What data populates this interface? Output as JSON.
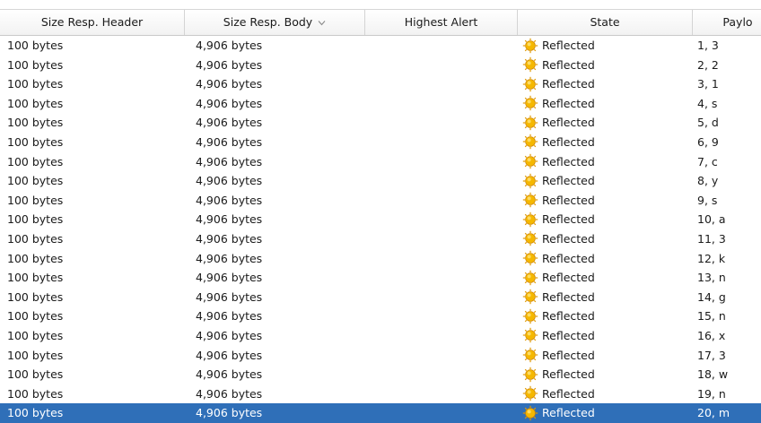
{
  "table": {
    "columns": [
      {
        "label": "Size Resp. Header"
      },
      {
        "label": "Size Resp. Body"
      },
      {
        "label": "Highest Alert"
      },
      {
        "label": "State"
      },
      {
        "label": "Paylo"
      }
    ],
    "sort_icon": "chevron-down-icon",
    "state_icon": "sun-icon",
    "rows": [
      {
        "header_size": "100 bytes",
        "body_size": "4,906 bytes",
        "alert": "",
        "state": "Reflected",
        "payload": "1, 3"
      },
      {
        "header_size": "100 bytes",
        "body_size": "4,906 bytes",
        "alert": "",
        "state": "Reflected",
        "payload": "2, 2"
      },
      {
        "header_size": "100 bytes",
        "body_size": "4,906 bytes",
        "alert": "",
        "state": "Reflected",
        "payload": "3, 1"
      },
      {
        "header_size": "100 bytes",
        "body_size": "4,906 bytes",
        "alert": "",
        "state": "Reflected",
        "payload": "4, s"
      },
      {
        "header_size": "100 bytes",
        "body_size": "4,906 bytes",
        "alert": "",
        "state": "Reflected",
        "payload": "5, d"
      },
      {
        "header_size": "100 bytes",
        "body_size": "4,906 bytes",
        "alert": "",
        "state": "Reflected",
        "payload": "6, 9"
      },
      {
        "header_size": "100 bytes",
        "body_size": "4,906 bytes",
        "alert": "",
        "state": "Reflected",
        "payload": "7, c"
      },
      {
        "header_size": "100 bytes",
        "body_size": "4,906 bytes",
        "alert": "",
        "state": "Reflected",
        "payload": "8, y"
      },
      {
        "header_size": "100 bytes",
        "body_size": "4,906 bytes",
        "alert": "",
        "state": "Reflected",
        "payload": "9, s"
      },
      {
        "header_size": "100 bytes",
        "body_size": "4,906 bytes",
        "alert": "",
        "state": "Reflected",
        "payload": "10, a"
      },
      {
        "header_size": "100 bytes",
        "body_size": "4,906 bytes",
        "alert": "",
        "state": "Reflected",
        "payload": "11, 3"
      },
      {
        "header_size": "100 bytes",
        "body_size": "4,906 bytes",
        "alert": "",
        "state": "Reflected",
        "payload": "12, k"
      },
      {
        "header_size": "100 bytes",
        "body_size": "4,906 bytes",
        "alert": "",
        "state": "Reflected",
        "payload": "13, n"
      },
      {
        "header_size": "100 bytes",
        "body_size": "4,906 bytes",
        "alert": "",
        "state": "Reflected",
        "payload": "14, g"
      },
      {
        "header_size": "100 bytes",
        "body_size": "4,906 bytes",
        "alert": "",
        "state": "Reflected",
        "payload": "15, n"
      },
      {
        "header_size": "100 bytes",
        "body_size": "4,906 bytes",
        "alert": "",
        "state": "Reflected",
        "payload": "16, x"
      },
      {
        "header_size": "100 bytes",
        "body_size": "4,906 bytes",
        "alert": "",
        "state": "Reflected",
        "payload": "17, 3"
      },
      {
        "header_size": "100 bytes",
        "body_size": "4,906 bytes",
        "alert": "",
        "state": "Reflected",
        "payload": "18, w"
      },
      {
        "header_size": "100 bytes",
        "body_size": "4,906 bytes",
        "alert": "",
        "state": "Reflected",
        "payload": "19, n"
      },
      {
        "header_size": "100 bytes",
        "body_size": "4,906 bytes",
        "alert": "",
        "state": "Reflected",
        "payload": "20, m",
        "selected": true
      }
    ]
  },
  "colors": {
    "selection": "#2f6fb8",
    "sun": "#f5b800"
  }
}
